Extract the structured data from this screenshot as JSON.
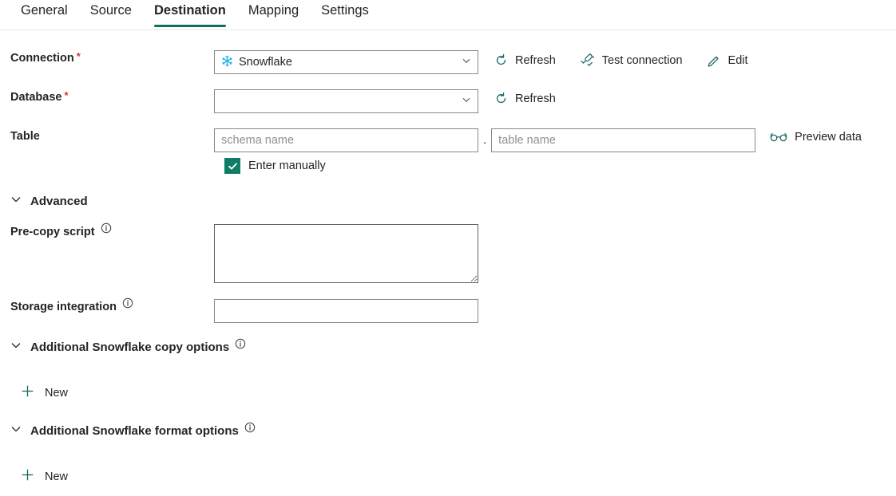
{
  "tabs": [
    {
      "label": "General",
      "active": false
    },
    {
      "label": "Source",
      "active": false
    },
    {
      "label": "Destination",
      "active": true
    },
    {
      "label": "Mapping",
      "active": false
    },
    {
      "label": "Settings",
      "active": false
    }
  ],
  "colors": {
    "accent_teal": "#0f6e62",
    "checkbox_teal": "#107c67",
    "icon_teal": "#1b6b68",
    "snowflake_blue": "#29b5e8",
    "required_red": "#d13438",
    "border_gray": "#8a8886",
    "placeholder_gray": "#8f8f8f",
    "text_primary": "#242424"
  },
  "connection": {
    "label": "Connection",
    "required": true,
    "value": "Snowflake",
    "icon": "snowflake-icon",
    "refresh_label": "Refresh",
    "test_connection_label": "Test connection",
    "edit_label": "Edit"
  },
  "database": {
    "label": "Database",
    "required": true,
    "value": "",
    "refresh_label": "Refresh"
  },
  "table": {
    "label": "Table",
    "required": false,
    "schema_value": "",
    "schema_placeholder": "schema name",
    "separator": ".",
    "table_value": "",
    "table_placeholder": "table name",
    "preview_data_label": "Preview data",
    "enter_manually_label": "Enter manually",
    "enter_manually_checked": true
  },
  "advanced": {
    "label": "Advanced",
    "expanded": true,
    "pre_copy_script": {
      "label": "Pre-copy script",
      "value": "",
      "has_info": true
    },
    "storage_integration": {
      "label": "Storage integration",
      "value": "",
      "has_info": true
    }
  },
  "copy_options": {
    "label": "Additional Snowflake copy options",
    "expanded": true,
    "has_info": true,
    "new_label": "New"
  },
  "format_options": {
    "label": "Additional Snowflake format options",
    "expanded": true,
    "has_info": true,
    "new_label": "New"
  }
}
